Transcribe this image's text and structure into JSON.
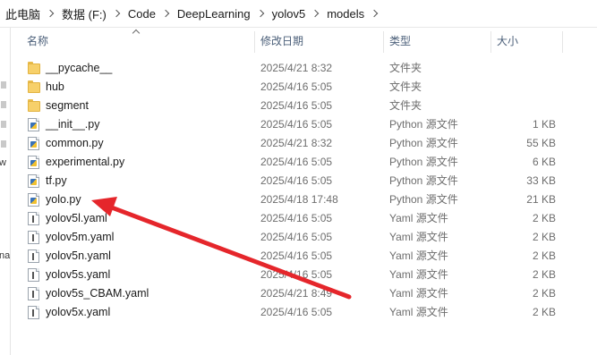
{
  "breadcrumb": [
    {
      "label": "此电脑"
    },
    {
      "label": "数据 (F:)"
    },
    {
      "label": "Code"
    },
    {
      "label": "DeepLearning"
    },
    {
      "label": "yolov5"
    },
    {
      "label": "models"
    }
  ],
  "nav_fragments": [
    "w",
    "na"
  ],
  "columns": {
    "name": "名称",
    "date": "修改日期",
    "type": "类型",
    "size": "大小"
  },
  "files": [
    {
      "name": "__pycache__",
      "date": "2025/4/21 8:32",
      "type": "文件夹",
      "size": "",
      "icon": "folder-icon"
    },
    {
      "name": "hub",
      "date": "2025/4/16 5:05",
      "type": "文件夹",
      "size": "",
      "icon": "folder-icon"
    },
    {
      "name": "segment",
      "date": "2025/4/16 5:05",
      "type": "文件夹",
      "size": "",
      "icon": "folder-icon"
    },
    {
      "name": "__init__.py",
      "date": "2025/4/16 5:05",
      "type": "Python 源文件",
      "size": "1 KB",
      "icon": "python-file-icon"
    },
    {
      "name": "common.py",
      "date": "2025/4/21 8:32",
      "type": "Python 源文件",
      "size": "55 KB",
      "icon": "python-file-icon"
    },
    {
      "name": "experimental.py",
      "date": "2025/4/16 5:05",
      "type": "Python 源文件",
      "size": "6 KB",
      "icon": "python-file-icon"
    },
    {
      "name": "tf.py",
      "date": "2025/4/16 5:05",
      "type": "Python 源文件",
      "size": "33 KB",
      "icon": "python-file-icon"
    },
    {
      "name": "yolo.py",
      "date": "2025/4/18 17:48",
      "type": "Python 源文件",
      "size": "21 KB",
      "icon": "python-file-icon"
    },
    {
      "name": "yolov5l.yaml",
      "date": "2025/4/16 5:05",
      "type": "Yaml 源文件",
      "size": "2 KB",
      "icon": "yaml-file-icon"
    },
    {
      "name": "yolov5m.yaml",
      "date": "2025/4/16 5:05",
      "type": "Yaml 源文件",
      "size": "2 KB",
      "icon": "yaml-file-icon"
    },
    {
      "name": "yolov5n.yaml",
      "date": "2025/4/16 5:05",
      "type": "Yaml 源文件",
      "size": "2 KB",
      "icon": "yaml-file-icon"
    },
    {
      "name": "yolov5s.yaml",
      "date": "2025/4/16 5:05",
      "type": "Yaml 源文件",
      "size": "2 KB",
      "icon": "yaml-file-icon"
    },
    {
      "name": "yolov5s_CBAM.yaml",
      "date": "2025/4/21 8:49",
      "type": "Yaml 源文件",
      "size": "2 KB",
      "icon": "yaml-file-icon"
    },
    {
      "name": "yolov5x.yaml",
      "date": "2025/4/16 5:05",
      "type": "Yaml 源文件",
      "size": "2 KB",
      "icon": "yaml-file-icon"
    }
  ],
  "annotation": {
    "color": "#e5262b",
    "points_to": "yolo.py"
  },
  "colors": {
    "folder": "#f7d06a",
    "header_text": "#4c607a",
    "secondary_text": "#6d6d6d"
  }
}
